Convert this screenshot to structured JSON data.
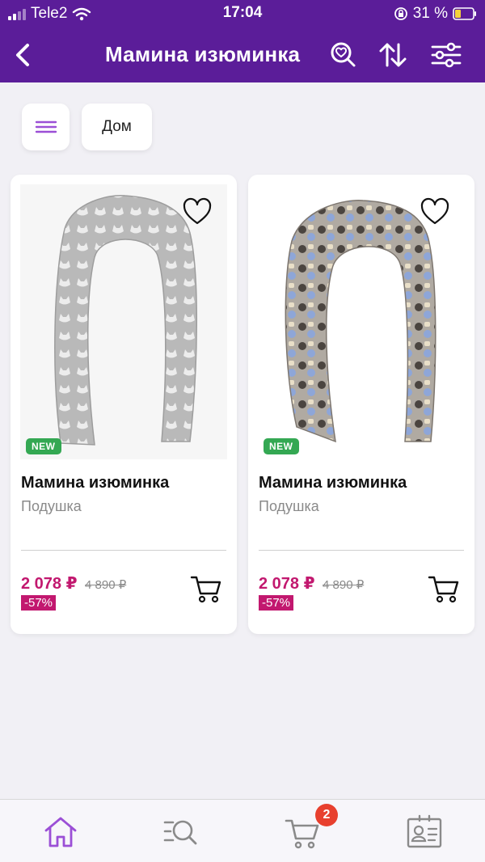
{
  "status": {
    "carrier": "Tele2",
    "time": "17:04",
    "battery": "31 %",
    "icons": [
      "signal-icon",
      "wifi-icon",
      "orientation-lock-icon",
      "battery-icon"
    ]
  },
  "nav": {
    "title": "Мамина изюминка",
    "icons": [
      "back-icon",
      "search-heart-icon",
      "sort-icon",
      "filter-icon"
    ]
  },
  "chips": {
    "menu_icon": "menu-icon",
    "category": "Дом"
  },
  "products": [
    {
      "badge": "NEW",
      "name": "Мамина изюминка",
      "subtitle": "Подушка",
      "price": "2 078 ₽",
      "old_price": "4 890 ₽",
      "discount": "-57%"
    },
    {
      "badge": "NEW",
      "name": "Мамина изюминка",
      "subtitle": "Подушка",
      "price": "2 078 ₽",
      "old_price": "4 890 ₽",
      "discount": "-57%"
    }
  ],
  "tabbar": {
    "tabs": [
      "home-icon",
      "search-icon",
      "cart-icon",
      "profile-card-icon"
    ],
    "cart_count": "2"
  },
  "colors": {
    "brand": "#5b1d99",
    "accent": "#9b4fd6",
    "price": "#c2186f",
    "new_badge": "#34a853",
    "cart_badge": "#e8402e"
  }
}
